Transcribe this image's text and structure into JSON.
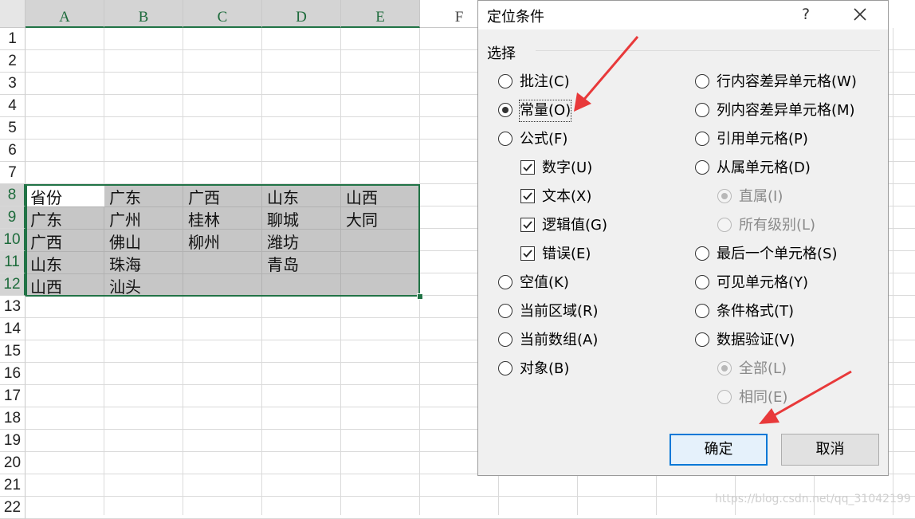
{
  "sheet": {
    "columns": [
      "A",
      "B",
      "C",
      "D",
      "E",
      "F"
    ],
    "rows": [
      "1",
      "2",
      "3",
      "4",
      "5",
      "6",
      "7",
      "8",
      "9",
      "10",
      "11",
      "12",
      "13",
      "14",
      "15",
      "16",
      "17",
      "18",
      "19",
      "20",
      "21",
      "22"
    ],
    "cells": [
      [
        "省份",
        "广东",
        "广西",
        "山东",
        "山西"
      ],
      [
        "广东",
        "广州",
        "桂林",
        "聊城",
        "大同"
      ],
      [
        "广西",
        "佛山",
        "柳州",
        "潍坊",
        ""
      ],
      [
        "山东",
        "珠海",
        "",
        "青岛",
        ""
      ],
      [
        "山西",
        "汕头",
        "",
        "",
        ""
      ]
    ]
  },
  "dialog": {
    "title": "定位条件",
    "help": "?",
    "group_label": "选择",
    "left_options": [
      {
        "label": "批注(C)",
        "kind": "radio",
        "checked": false
      },
      {
        "label": "常量(O)",
        "kind": "radio",
        "checked": true
      },
      {
        "label": "公式(F)",
        "kind": "radio",
        "checked": false
      },
      {
        "label": "数字(U)",
        "kind": "checkbox",
        "checked": true
      },
      {
        "label": "文本(X)",
        "kind": "checkbox",
        "checked": true
      },
      {
        "label": "逻辑值(G)",
        "kind": "checkbox",
        "checked": true
      },
      {
        "label": "错误(E)",
        "kind": "checkbox",
        "checked": true
      },
      {
        "label": "空值(K)",
        "kind": "radio",
        "checked": false
      },
      {
        "label": "当前区域(R)",
        "kind": "radio",
        "checked": false
      },
      {
        "label": "当前数组(A)",
        "kind": "radio",
        "checked": false
      },
      {
        "label": "对象(B)",
        "kind": "radio",
        "checked": false
      }
    ],
    "right_options": [
      {
        "label": "行内容差异单元格(W)",
        "kind": "radio",
        "checked": false
      },
      {
        "label": "列内容差异单元格(M)",
        "kind": "radio",
        "checked": false
      },
      {
        "label": "引用单元格(P)",
        "kind": "radio",
        "checked": false
      },
      {
        "label": "从属单元格(D)",
        "kind": "radio",
        "checked": false
      },
      {
        "label": "直属(I)",
        "kind": "radio",
        "checked": true,
        "disabled": true
      },
      {
        "label": "所有级别(L)",
        "kind": "radio",
        "checked": false,
        "disabled": true
      },
      {
        "label": "最后一个单元格(S)",
        "kind": "radio",
        "checked": false
      },
      {
        "label": "可见单元格(Y)",
        "kind": "radio",
        "checked": false
      },
      {
        "label": "条件格式(T)",
        "kind": "radio",
        "checked": false
      },
      {
        "label": "数据验证(V)",
        "kind": "radio",
        "checked": false
      },
      {
        "label": "全部(L)",
        "kind": "radio",
        "checked": true,
        "disabled": true
      },
      {
        "label": "相同(E)",
        "kind": "radio",
        "checked": false,
        "disabled": true
      }
    ],
    "ok_label": "确定",
    "cancel_label": "取消"
  },
  "watermark": "https://blog.csdn.net/qq_31042199",
  "colors": {
    "accent": "#217346",
    "arrow": "#e8393a",
    "default_button_border": "#0078d7"
  }
}
